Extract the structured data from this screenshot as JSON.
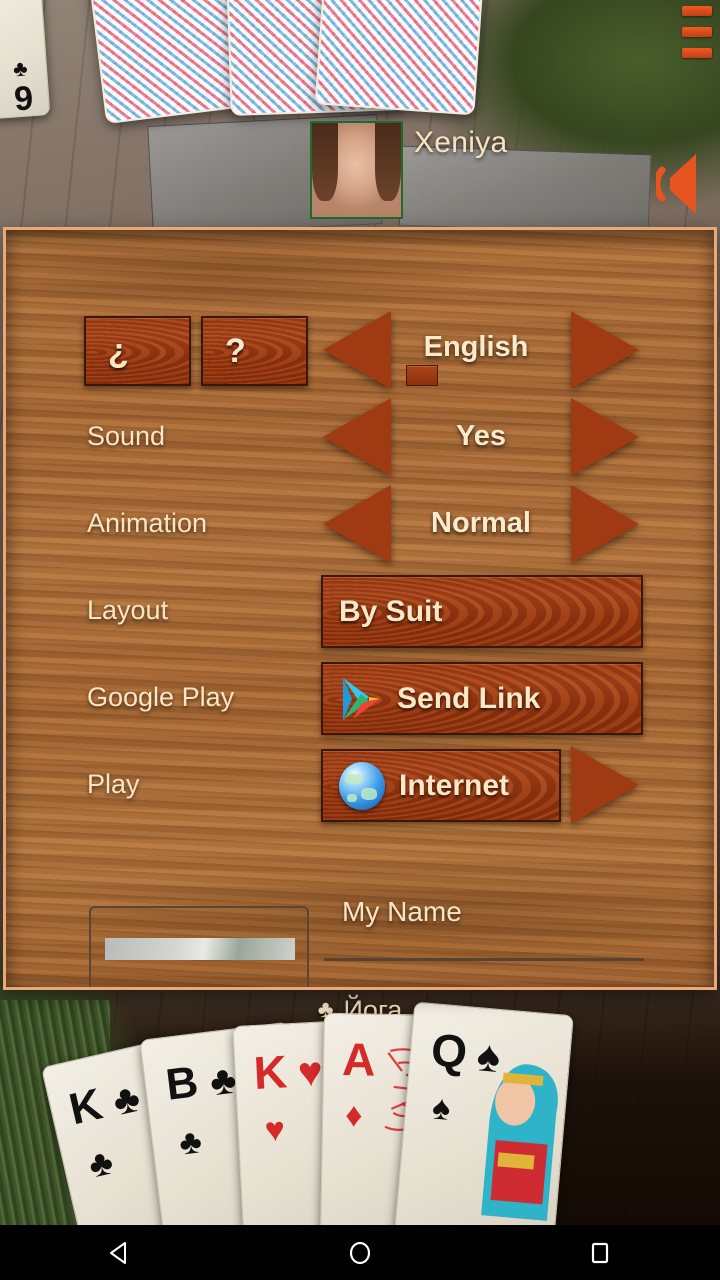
{
  "game": {
    "opponent_name": "Xeniya",
    "turn_suit": "♣",
    "turn_player": "Йога",
    "hand_cards": [
      {
        "rank": "K",
        "suit": "♣",
        "color": "black"
      },
      {
        "rank": "B",
        "suit": "♣",
        "color": "black"
      },
      {
        "rank": "K",
        "suit": "♥",
        "color": "red"
      },
      {
        "rank": "A",
        "suit": "♦",
        "color": "red"
      },
      {
        "rank": "Q",
        "suit": "♠",
        "color": "black"
      }
    ],
    "left_card": {
      "rank": "9",
      "suit": "♣",
      "color": "black"
    },
    "icons": {
      "menu": "hamburger-menu-icon",
      "sound": "sound-on-icon"
    }
  },
  "settings": {
    "help_button": "¿",
    "question_button": "?",
    "rows": [
      {
        "label": "",
        "value": "English",
        "name": "language"
      },
      {
        "label": "Sound",
        "value": "Yes",
        "name": "sound"
      },
      {
        "label": "Animation",
        "value": "Normal",
        "name": "animation"
      },
      {
        "label": "Layout",
        "value": "By Suit",
        "name": "layout"
      },
      {
        "label": "Google Play",
        "value": "Send Link",
        "name": "google-play"
      },
      {
        "label": "Play",
        "value": "Internet",
        "name": "play"
      }
    ],
    "name_field": {
      "label": "My Name",
      "value": "",
      "placeholder": ""
    }
  },
  "navbar": {
    "back": "back-icon",
    "home": "home-icon",
    "recents": "recents-icon"
  },
  "colors": {
    "panel_wood": "#b0723c",
    "button_wood": "#a8451a",
    "text_cream": "#fbe5c2",
    "accent_orange": "#f05a23",
    "avatar_border": "#1f6b2a"
  }
}
